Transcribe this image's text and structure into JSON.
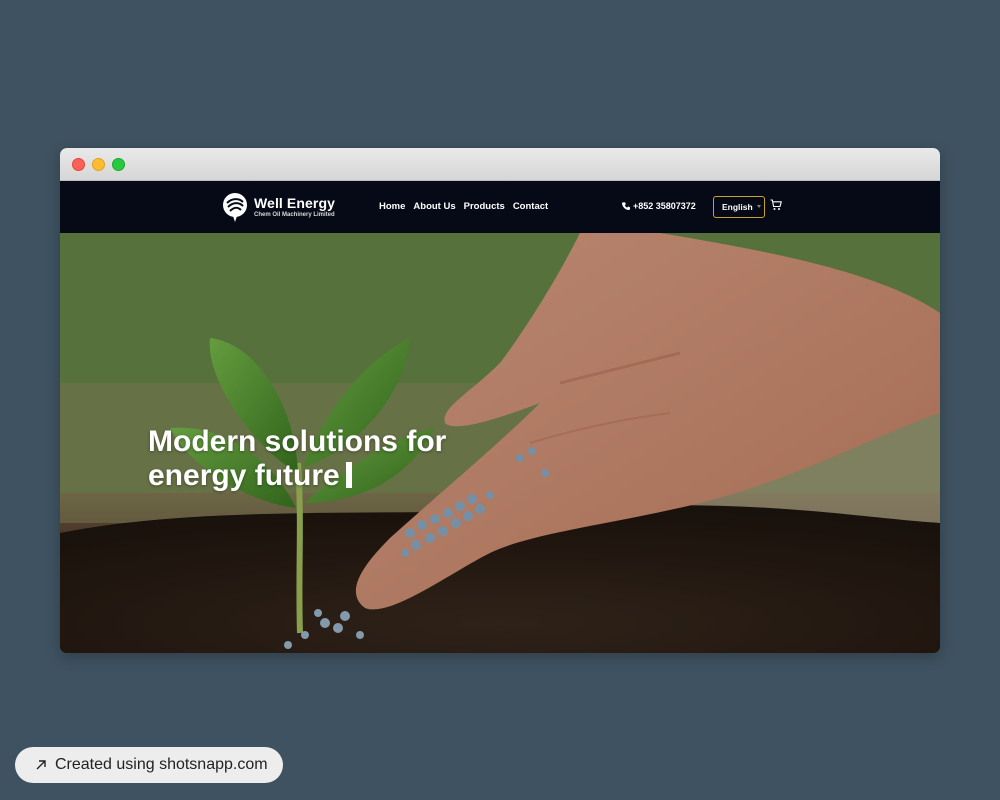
{
  "window": {
    "controls": [
      "close",
      "minimize",
      "maximize"
    ]
  },
  "brand": {
    "name": "Well Energy",
    "tagline": "Chem Oil Machinery Limited",
    "icon": "leaf-logo-icon"
  },
  "nav": {
    "items": [
      {
        "label": "Home"
      },
      {
        "label": "About Us"
      },
      {
        "label": "Products"
      },
      {
        "label": "Contact"
      }
    ]
  },
  "contact": {
    "phone": "+852 35807372",
    "icon": "phone-icon"
  },
  "language": {
    "selected": "English"
  },
  "cart": {
    "icon": "cart-icon"
  },
  "hero": {
    "headline_line1": "Modern solutions for",
    "headline_line2": "energy future"
  },
  "footer_badge": {
    "text": "Created using shotsnapp.com",
    "icon": "arrow-up-right-icon"
  },
  "colors": {
    "page_bg": "#3f5261",
    "navbar_bg": "#050a16",
    "accent_border": "#c9a227",
    "text_light": "#ffffff"
  }
}
